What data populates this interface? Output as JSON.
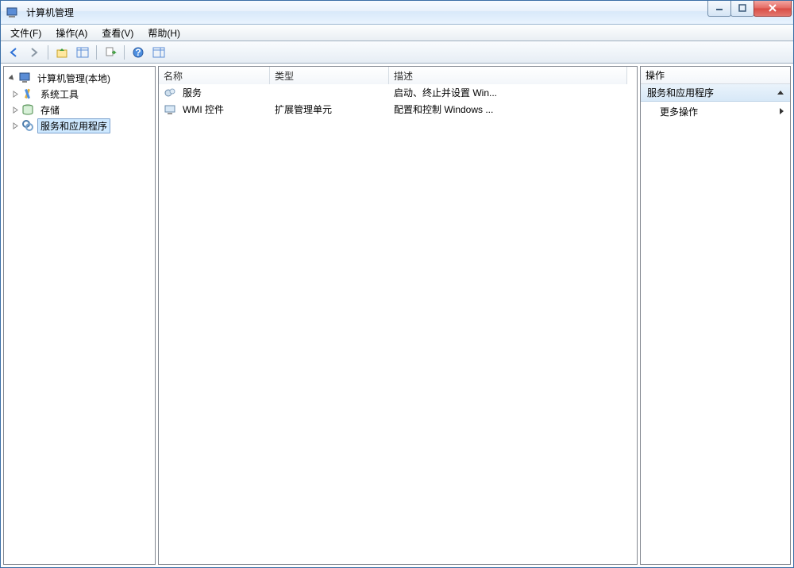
{
  "window": {
    "title": "计算机管理"
  },
  "menus": {
    "file": "文件(F)",
    "action": "操作(A)",
    "view": "查看(V)",
    "help": "帮助(H)"
  },
  "tree": {
    "root": "计算机管理(本地)",
    "system_tools": "系统工具",
    "storage": "存储",
    "services_apps": "服务和应用程序"
  },
  "list": {
    "columns": {
      "name": "名称",
      "type": "类型",
      "desc": "描述"
    },
    "rows": [
      {
        "name": "服务",
        "type": "",
        "desc": "启动、终止并设置 Win..."
      },
      {
        "name": "WMI 控件",
        "type": "扩展管理单元",
        "desc": "配置和控制 Windows ..."
      }
    ]
  },
  "actions": {
    "header": "操作",
    "section": "服务和应用程序",
    "more": "更多操作"
  }
}
